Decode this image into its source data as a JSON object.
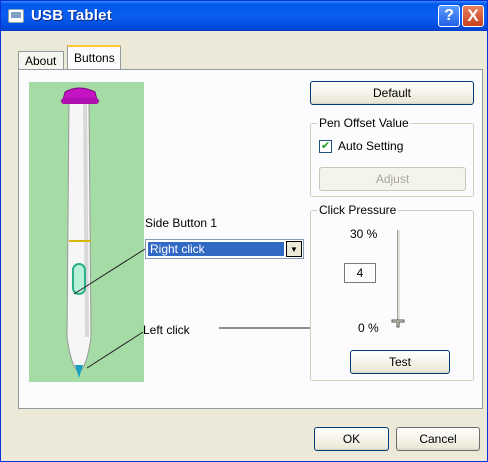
{
  "window": {
    "title": "USB Tablet"
  },
  "titlebar": {
    "help_label": "?",
    "close_label": "X"
  },
  "tabs": [
    {
      "label": "About"
    },
    {
      "label": "Buttons"
    }
  ],
  "buttons_tab": {
    "default_label": "Default",
    "pen_offset": {
      "label": "Pen Offset Value",
      "auto_setting_label": "Auto Setting",
      "auto_setting_checked": true,
      "adjust_label": "Adjust"
    },
    "side_button": {
      "label": "Side Button 1",
      "selected": "Right click"
    },
    "tip_label": "Left click",
    "click_pressure": {
      "label": "Click Pressure",
      "max_label": "30 %",
      "min_label": "0 %",
      "value": "4",
      "test_label": "Test"
    }
  },
  "footer": {
    "ok_label": "OK",
    "cancel_label": "Cancel"
  },
  "colors": {
    "title_blue": "#0058ee",
    "pen_bg": "#a5dba5",
    "cap_purple": "#c414c4",
    "selection": "#316ac5"
  }
}
